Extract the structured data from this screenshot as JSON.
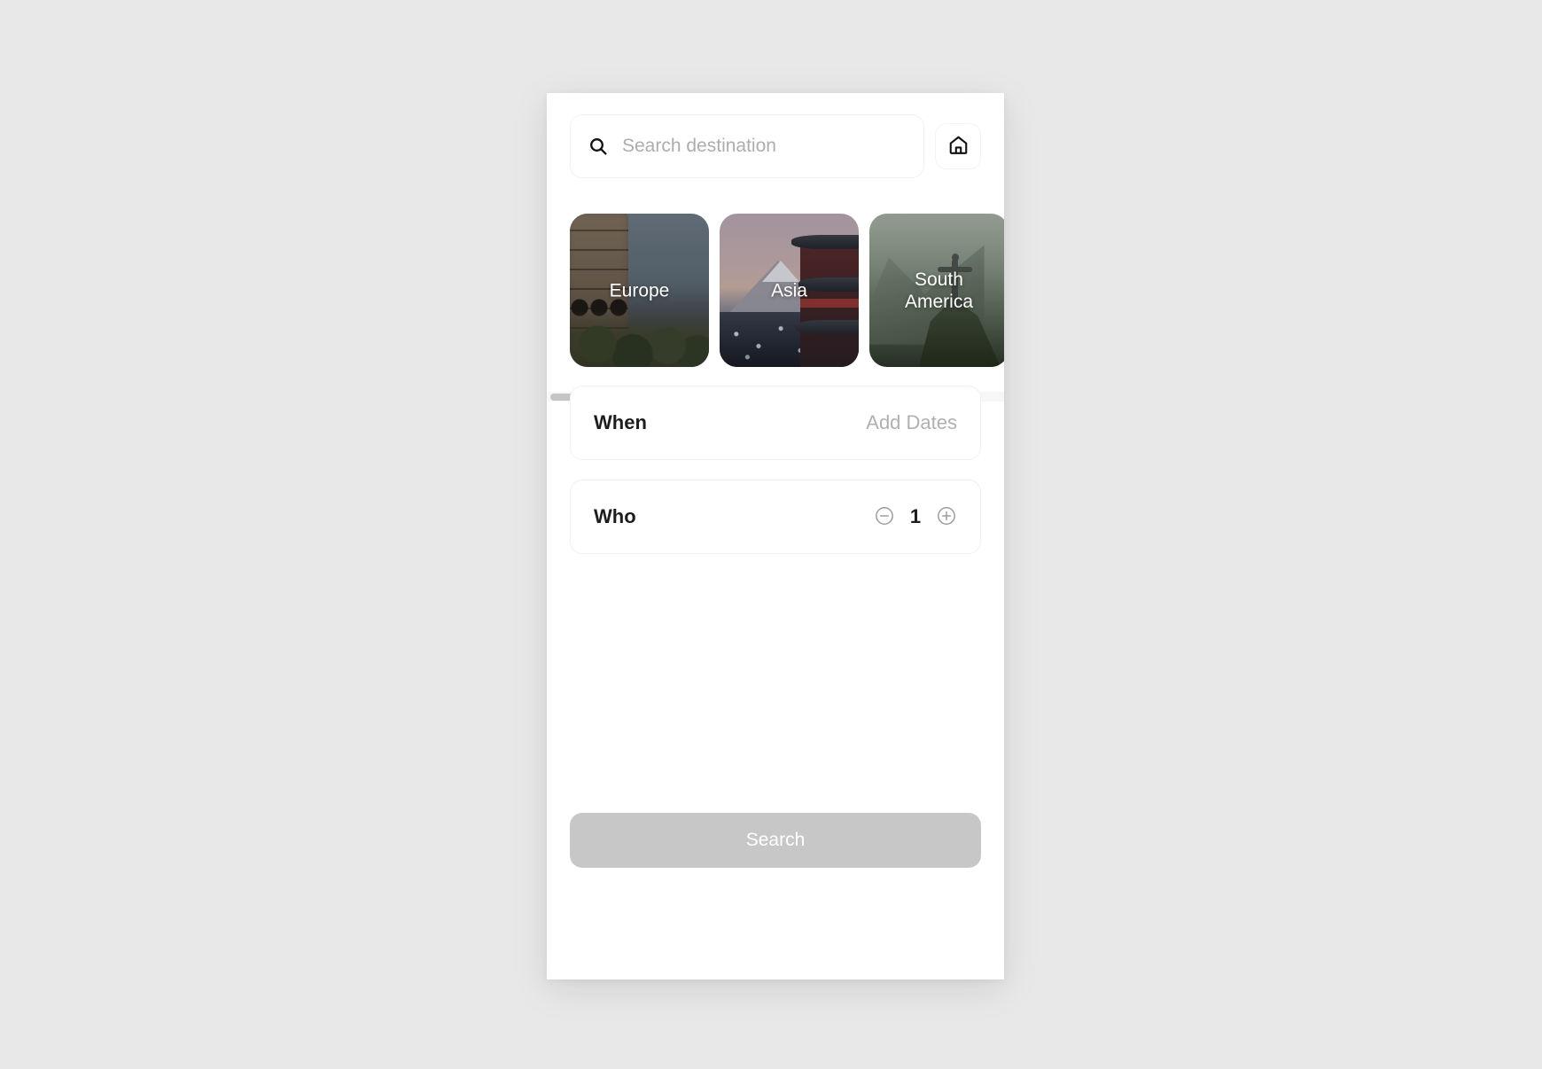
{
  "search": {
    "placeholder": "Search destination",
    "value": "",
    "icon": "search-icon"
  },
  "home_button": {
    "icon": "home-icon",
    "label": "Home"
  },
  "destinations": [
    {
      "label": "Europe",
      "icon": "colosseum-image"
    },
    {
      "label": "Asia",
      "icon": "mount-fuji-image"
    },
    {
      "label": "South\nAmerica",
      "icon": "christ-redeemer-image"
    }
  ],
  "when": {
    "label": "When",
    "value": "Add Dates"
  },
  "who": {
    "label": "Who",
    "count": "1",
    "decrement_icon": "minus-circle-icon",
    "increment_icon": "plus-circle-icon"
  },
  "cta": {
    "label": "Search"
  },
  "colors": {
    "background": "#e8e8e8",
    "panel": "#ffffff",
    "text_primary": "#1d1d1d",
    "text_muted": "#b0b0b0",
    "cta_disabled": "#c7c7c7",
    "scroll_thumb": "#c5c5c5"
  }
}
